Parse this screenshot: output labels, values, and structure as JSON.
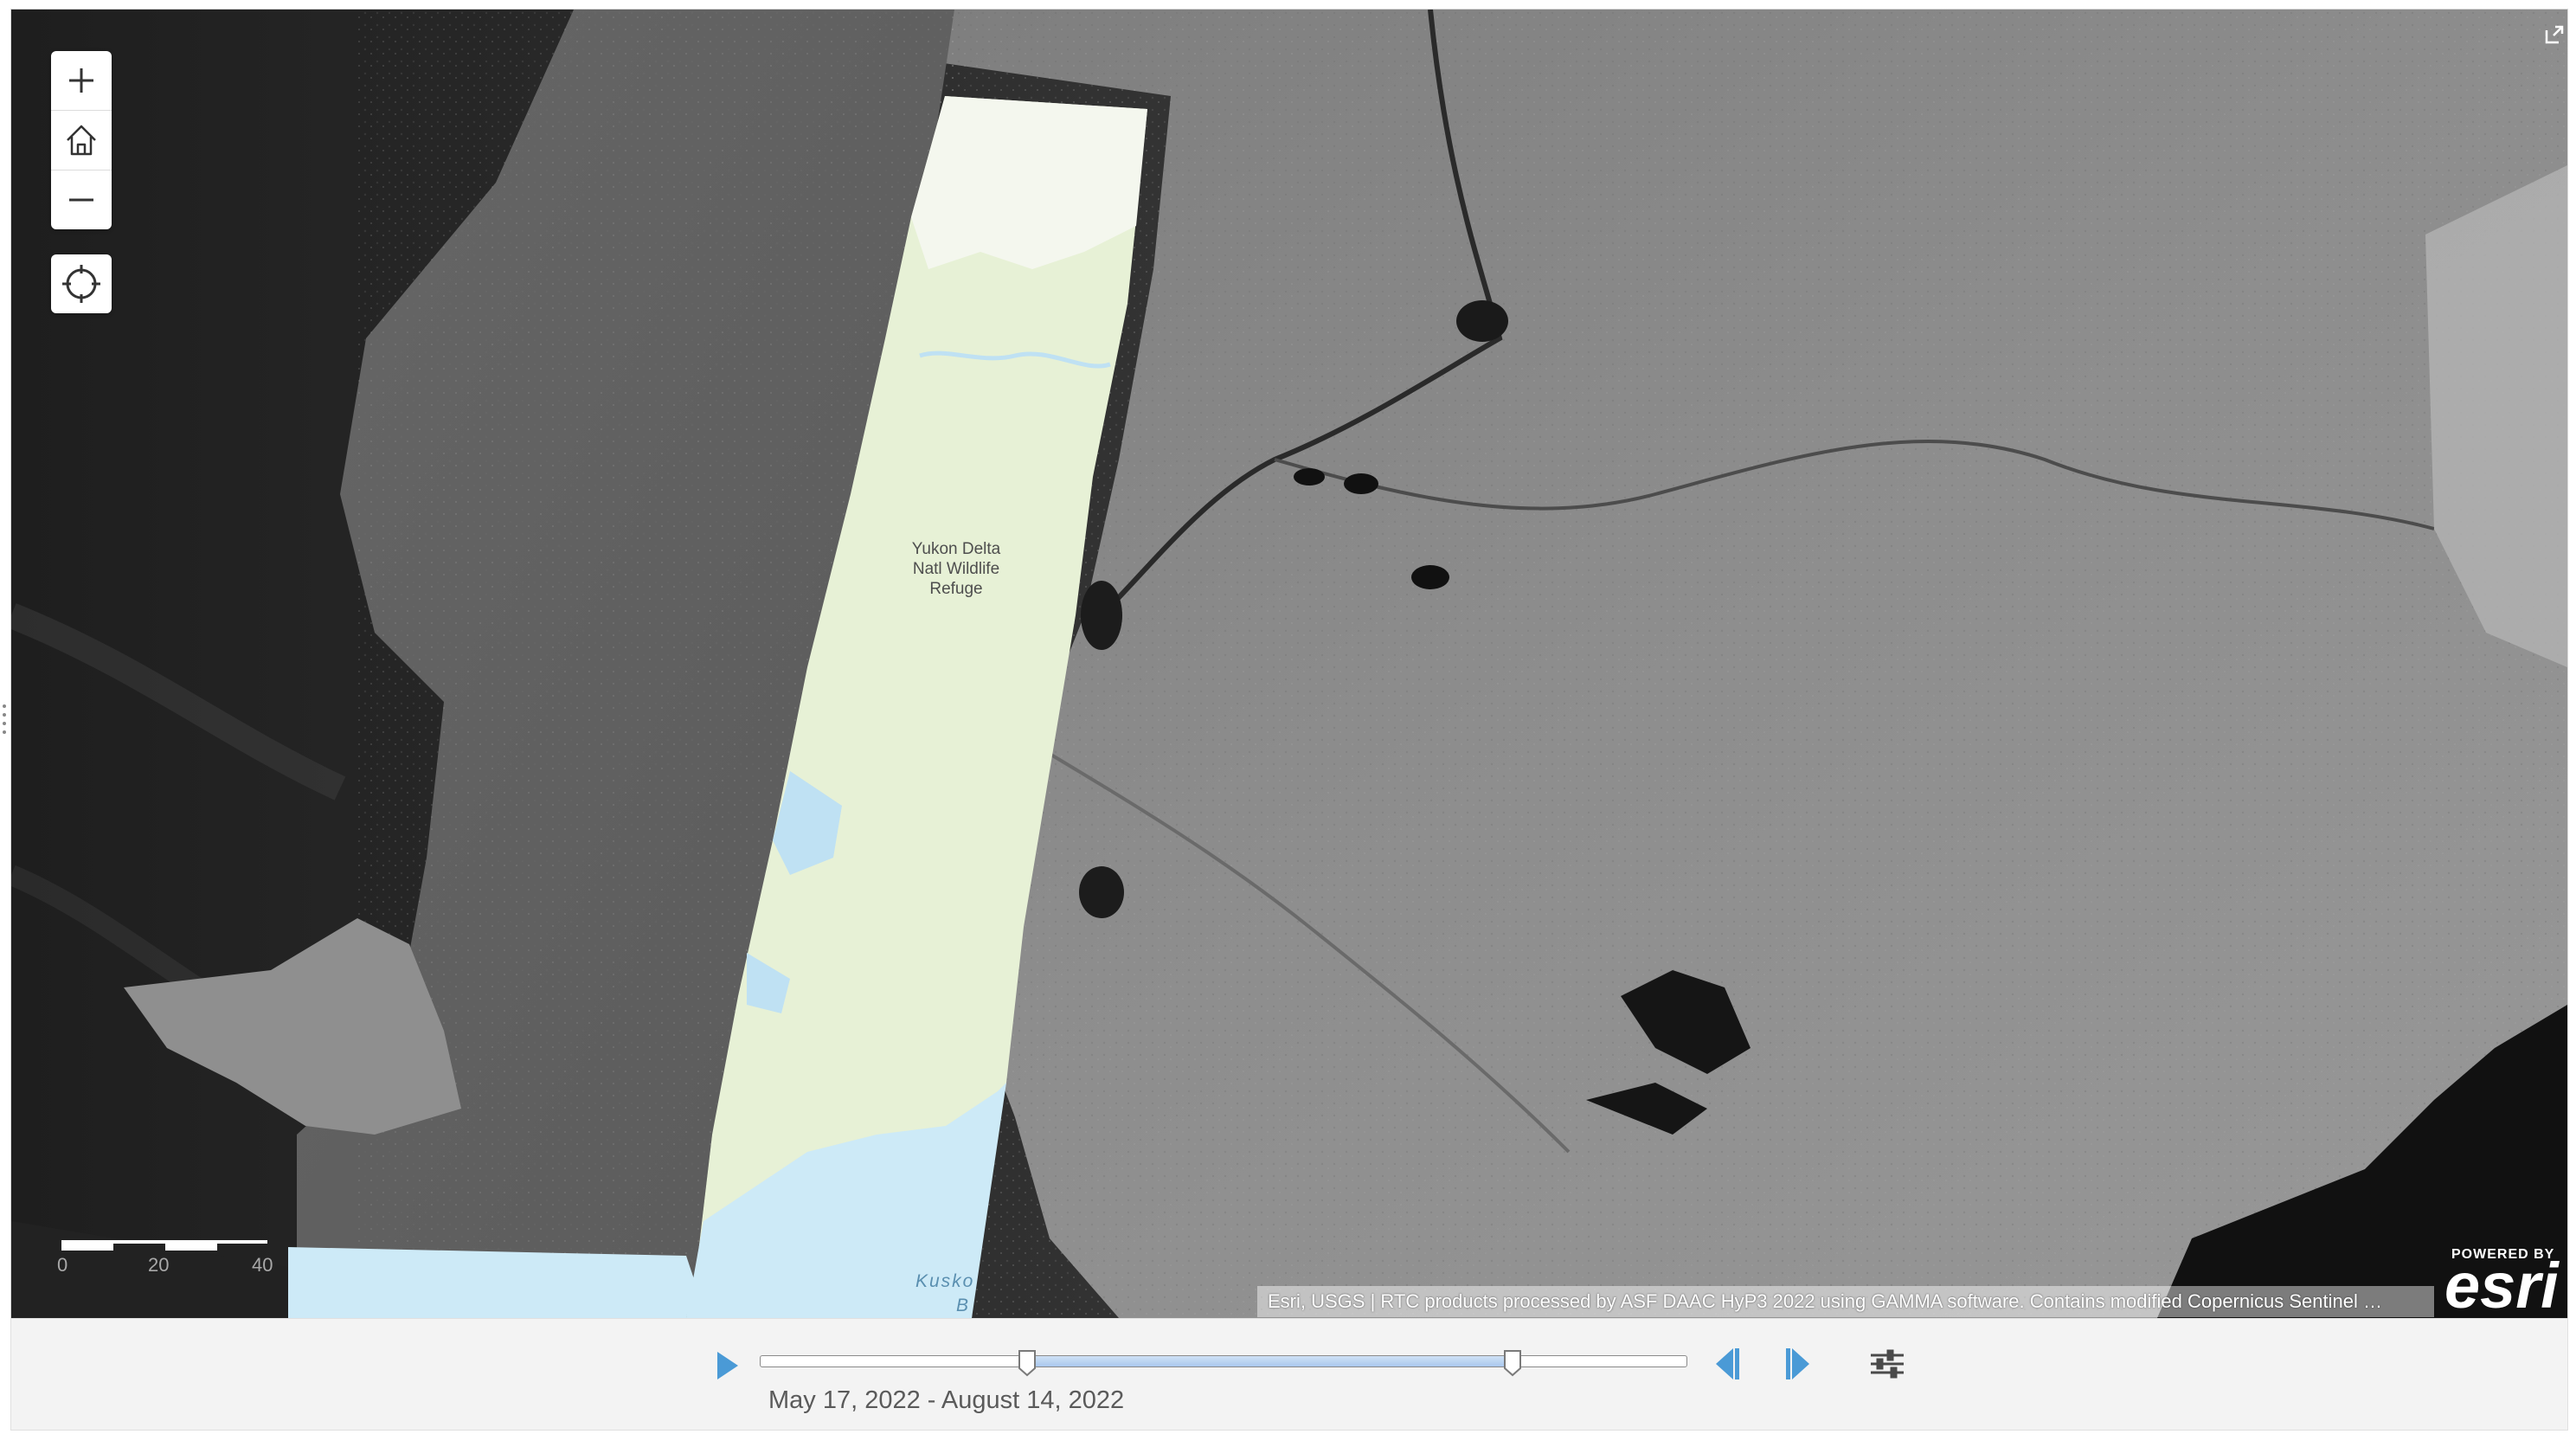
{
  "map": {
    "place_label": "Yukon Delta\nNatl Wildlife\nRefuge",
    "water_label": "Kusko\n      B",
    "attribution": "Esri, USGS | RTC products processed by ASF DAAC HyP3 2022 using GAMMA software. Contains modified Copernicus Sentinel …",
    "logo": {
      "powered_by": "POWERED BY",
      "wordmark": "esri"
    },
    "scale": {
      "ticks": [
        "0",
        "20",
        "40"
      ],
      "unit_text_truncated": "40mi"
    },
    "controls": {
      "zoom_in": "zoom-in-icon",
      "home": "home-icon",
      "zoom_out": "zoom-out-icon",
      "locate": "locate-icon",
      "expand": "expand-icon"
    }
  },
  "timeslider": {
    "extent_text": "May 17, 2022 - August 14, 2022",
    "start_fraction": 0.288,
    "end_fraction": 0.812,
    "accent": "#4a9ad6"
  }
}
